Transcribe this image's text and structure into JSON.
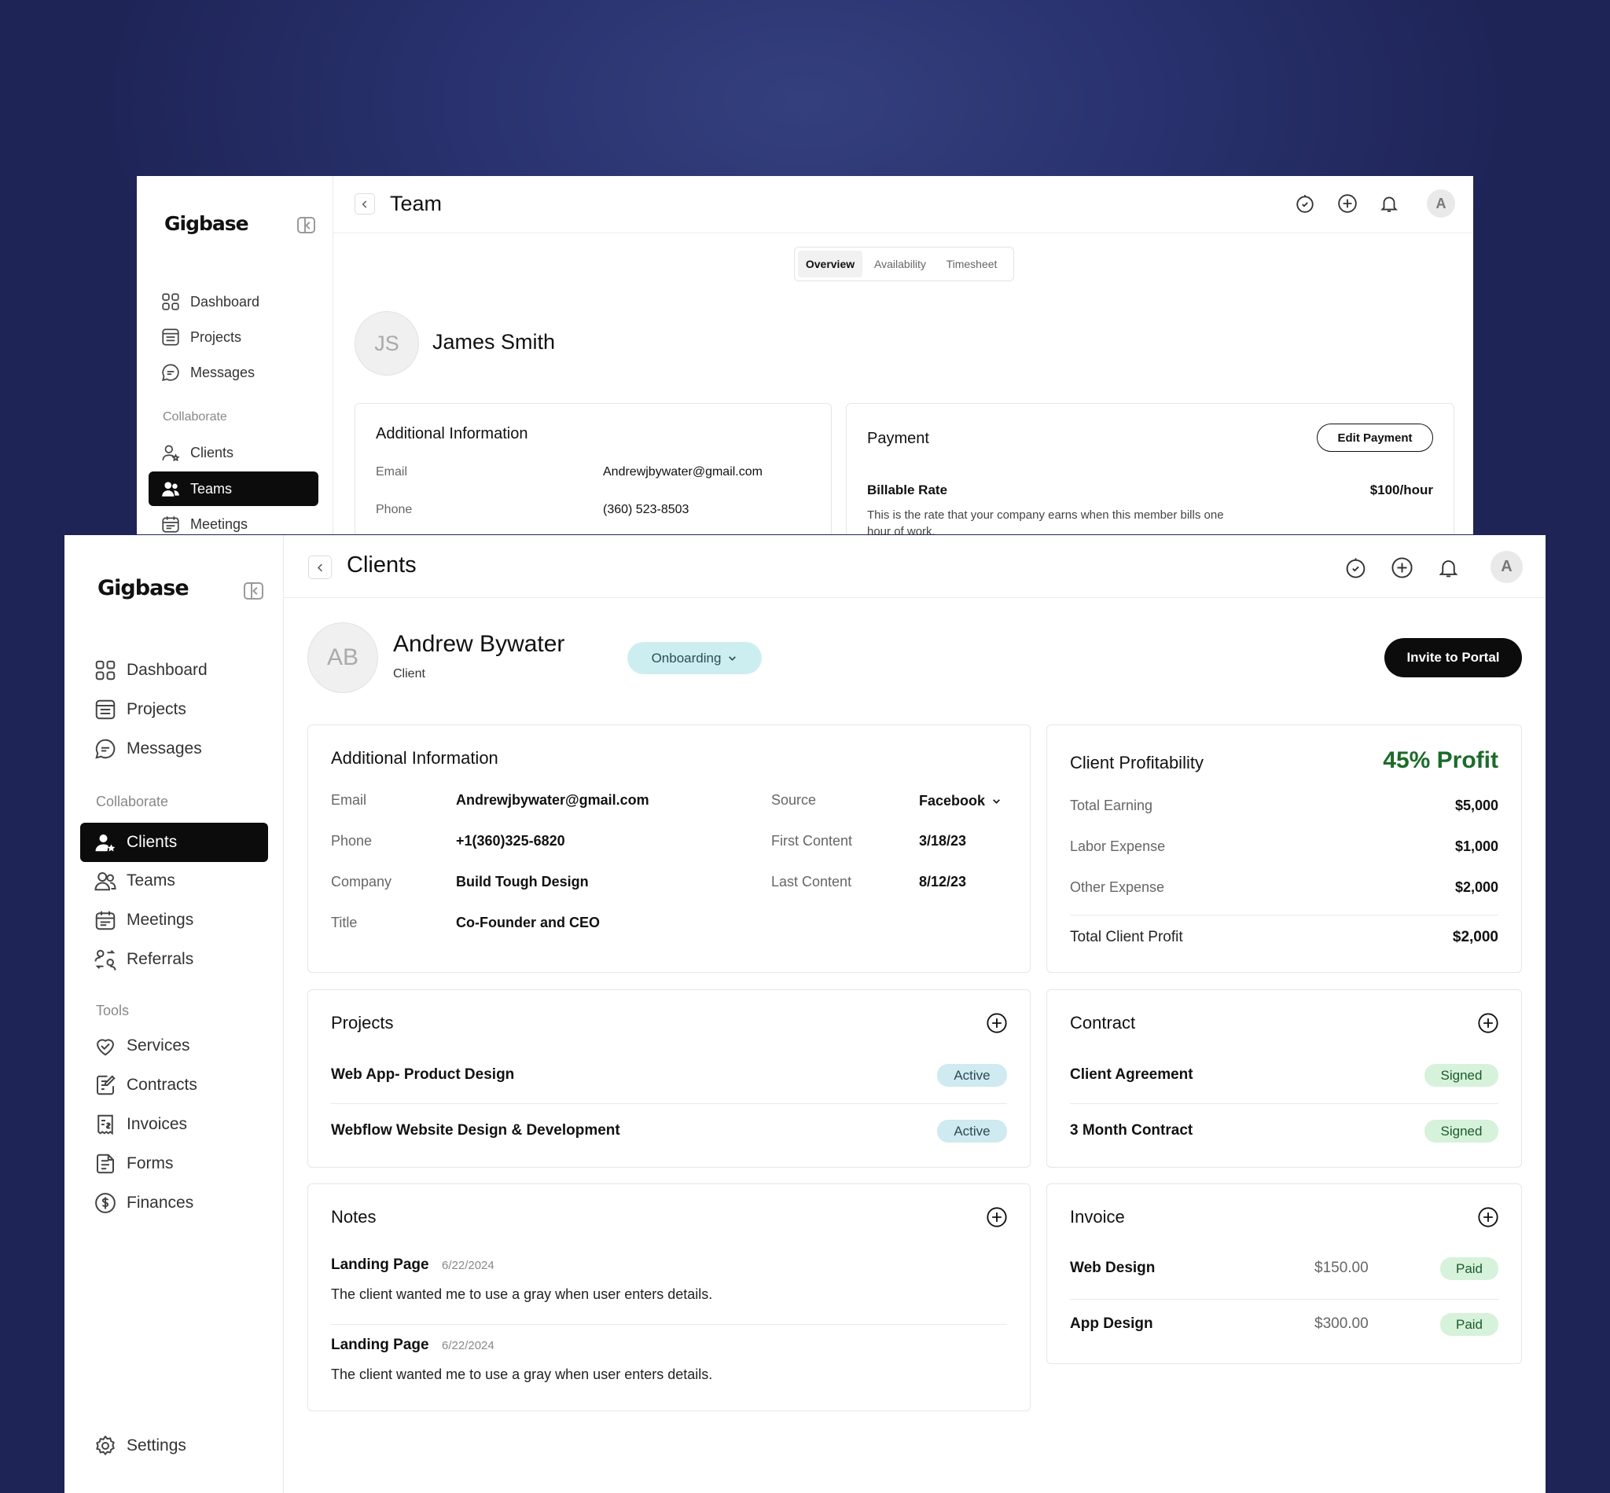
{
  "team_window": {
    "logo": "Gigbase",
    "nav": [
      "Dashboard",
      "Projects",
      "Messages"
    ],
    "section_collaborate": "Collaborate",
    "collab_nav": [
      "Clients",
      "Teams",
      "Meetings"
    ],
    "title": "Team",
    "avatar_initial": "A",
    "tabs": [
      "Overview",
      "Availability",
      "Timesheet"
    ],
    "member": {
      "initials": "JS",
      "name": "James Smith"
    },
    "additional_info": {
      "title": "Additional Information",
      "email_label": "Email",
      "email": "Andrewjbywater@gmail.com",
      "phone_label": "Phone",
      "phone": "(360) 523-8503"
    },
    "payment": {
      "title": "Payment",
      "edit_button": "Edit Payment",
      "rate_label": "Billable Rate",
      "rate": "$100/hour",
      "rate_desc": "This is the rate that your company earns when this member bills one hour of work."
    }
  },
  "clients_window": {
    "logo": "Gigbase",
    "nav": [
      "Dashboard",
      "Projects",
      "Messages"
    ],
    "section_collaborate": "Collaborate",
    "collab_nav": [
      "Clients",
      "Teams",
      "Meetings",
      "Referrals"
    ],
    "section_tools": "Tools",
    "tools_nav": [
      "Services",
      "Contracts",
      "Invoices",
      "Forms",
      "Finances"
    ],
    "settings": "Settings",
    "title": "Clients",
    "avatar_initial": "A",
    "client": {
      "initials": "AB",
      "name": "Andrew Bywater",
      "role": "Client",
      "status": "Onboarding",
      "invite_button": "Invite to Portal"
    },
    "additional_info": {
      "title": "Additional Information",
      "left": [
        {
          "label": "Email",
          "value": "Andrewjbywater@gmail.com"
        },
        {
          "label": "Phone",
          "value": "+1(360)325-6820"
        },
        {
          "label": "Company",
          "value": "Build Tough Design"
        },
        {
          "label": "Title",
          "value": "Co-Founder and CEO"
        }
      ],
      "right": [
        {
          "label": "Source",
          "value": "Facebook"
        },
        {
          "label": "First Content",
          "value": "3/18/23"
        },
        {
          "label": "Last Content",
          "value": "8/12/23"
        }
      ]
    },
    "profitability": {
      "title": "Client Profitability",
      "profit": "45% Profit",
      "rows": [
        {
          "label": "Total Earning",
          "value": "$5,000"
        },
        {
          "label": "Labor Expense",
          "value": "$1,000"
        },
        {
          "label": "Other Expense",
          "value": "$2,000"
        }
      ],
      "total_label": "Total Client Profit",
      "total_value": "$2,000"
    },
    "projects": {
      "title": "Projects",
      "items": [
        {
          "name": "Web App- Product Design",
          "status": "Active"
        },
        {
          "name": "Webflow Website Design & Development",
          "status": "Active"
        }
      ]
    },
    "contract": {
      "title": "Contract",
      "items": [
        {
          "name": "Client Agreement",
          "status": "Signed"
        },
        {
          "name": "3 Month Contract",
          "status": "Signed"
        }
      ]
    },
    "notes": {
      "title": "Notes",
      "items": [
        {
          "title": "Landing Page",
          "date": "6/22/2024",
          "text": "The client wanted me to use a gray when user enters details."
        },
        {
          "title": "Landing Page",
          "date": "6/22/2024",
          "text": "The client wanted me to use a gray when user enters details."
        }
      ]
    },
    "invoice": {
      "title": "Invoice",
      "items": [
        {
          "name": "Web Design",
          "amount": "$150.00",
          "status": "Paid"
        },
        {
          "name": "App Design",
          "amount": "$300.00",
          "status": "Paid"
        }
      ]
    }
  },
  "colors": {
    "profit_green": "#1c6b2a",
    "accent_black": "#0c0c0c",
    "onboarding_bg": "#cdeef0"
  }
}
